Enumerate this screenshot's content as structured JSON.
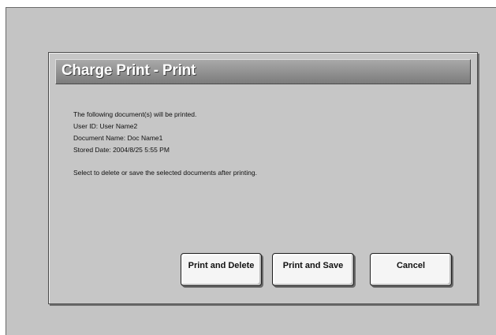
{
  "dialog": {
    "title": "Charge Print - Print",
    "lines": [
      "The following document(s) will be printed.",
      "User ID: User Name2",
      "Document Name: Doc Name1",
      "Stored Date: 2004/8/25 5:55 PM"
    ],
    "instruction": "Select to delete or save the selected documents after printing.",
    "buttons": {
      "print_and_delete": "Print and Delete",
      "print_and_save": "Print and Save",
      "cancel": "Cancel"
    }
  }
}
